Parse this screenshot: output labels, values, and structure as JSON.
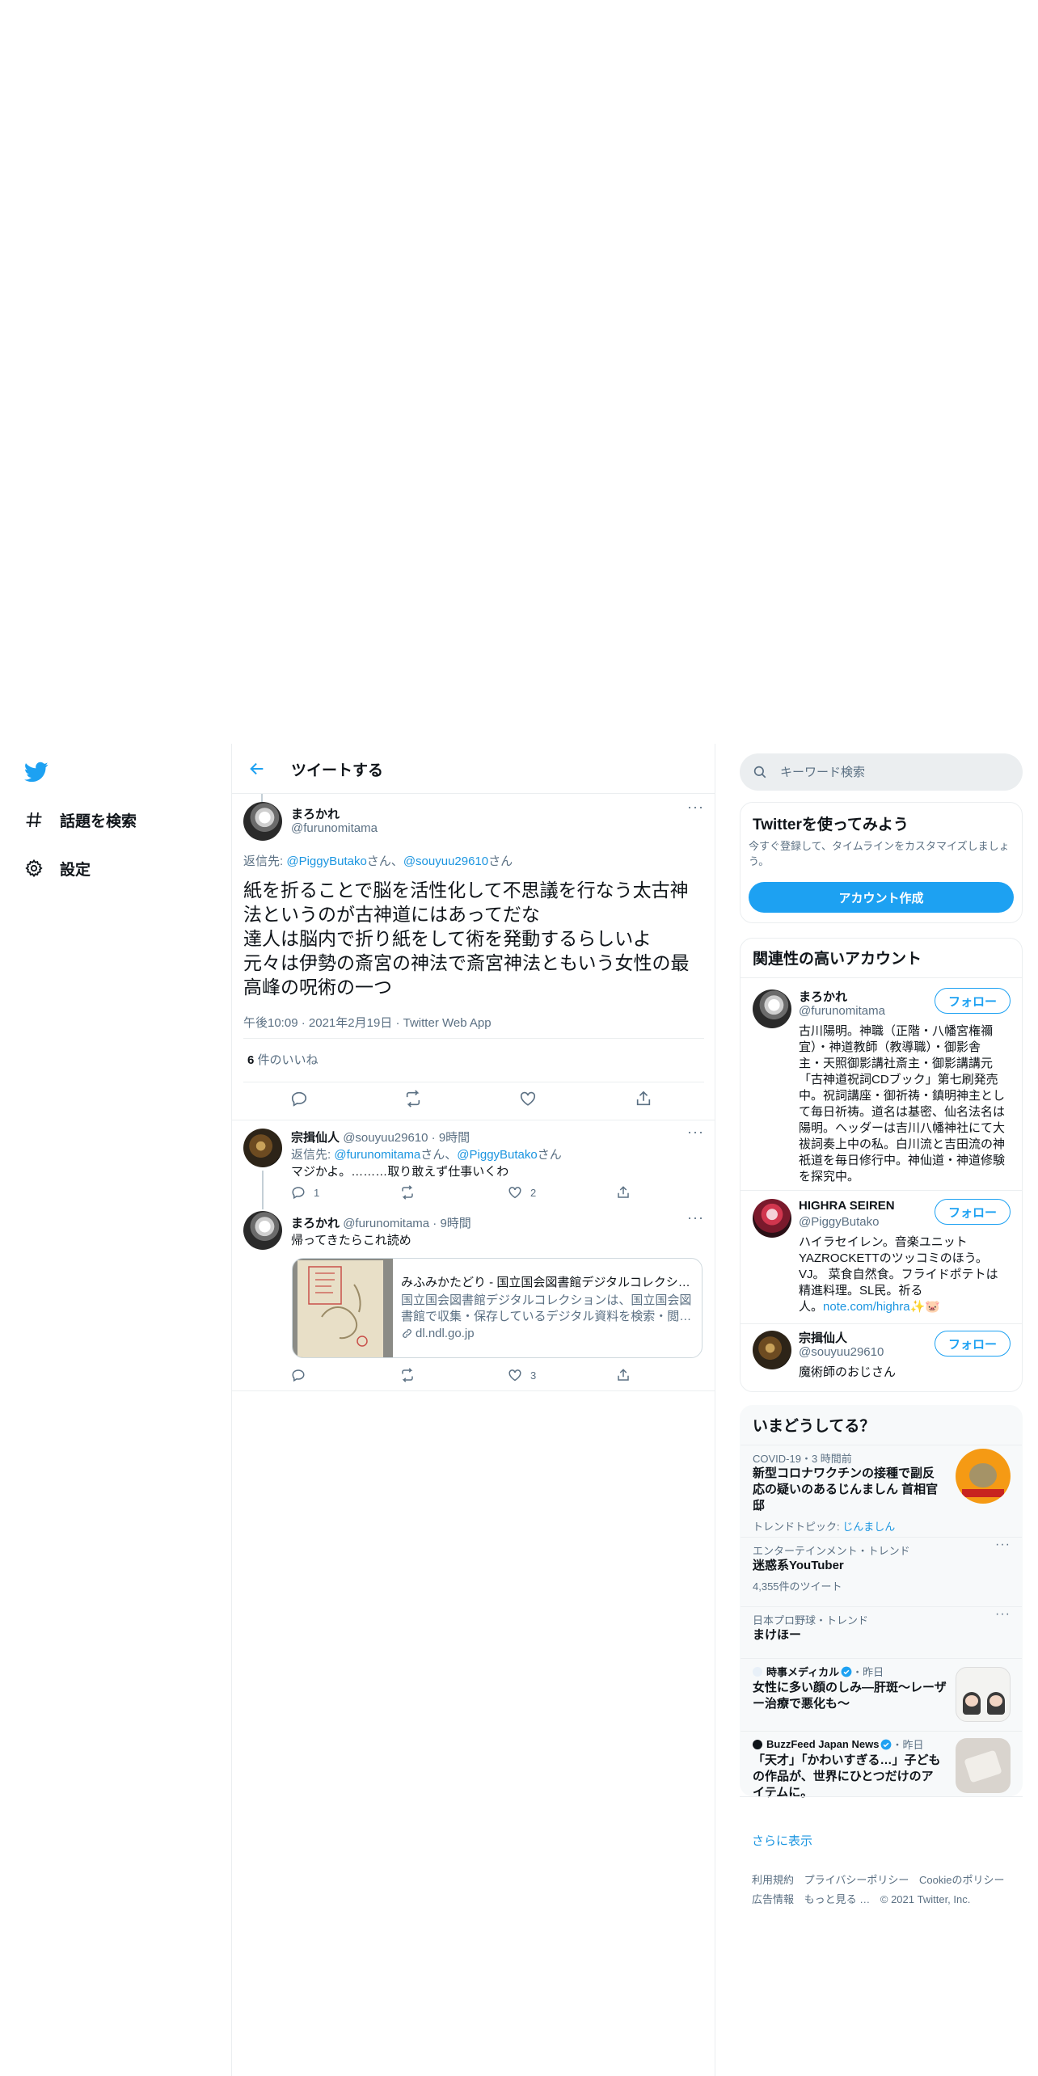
{
  "nav": {
    "logo": "twitter-bird-icon",
    "items": [
      {
        "icon": "hashtag-icon",
        "label": "話題を検索"
      },
      {
        "icon": "gear-icon",
        "label": "設定"
      }
    ]
  },
  "header": {
    "title": "ツイートする"
  },
  "tweet": {
    "name": "まろかれ",
    "handle": "@furunomitama",
    "reply_prefix": "返信先: ",
    "reply_user1": "@PiggyButako",
    "reply_sep1": "さん、",
    "reply_user2": "@souyuu29610",
    "reply_sep2": "さん",
    "text_lines": [
      "紙を折ることで脳を活性化して不思議を行なう太古神",
      "法というのが古神道にはあってだな",
      "達人は脳内で折り紙をして術を発動するらしいよ",
      "元々は伊勢の斎宮の神法で斎宮神法ともいう女性の最",
      "高峰の呪術の一つ"
    ],
    "time": "午後10:09",
    "date": "2021年2月19日",
    "source": "Twitter Web App",
    "likes_count": "6",
    "likes_label": " 件のいいね"
  },
  "replies": [
    {
      "name": "宗揖仙人",
      "handle": "@souyuu29610",
      "time": "9時間",
      "reply_prefix": "返信先: ",
      "reply_user1": "@furunomitama",
      "reply_sep1": "さん、",
      "reply_user2": "@PiggyButako",
      "reply_sep2": "さん",
      "text": "マジかよ。………取り敢えず仕事いくわ",
      "reply_count": "1",
      "retweet_count": "",
      "like_count": "2"
    },
    {
      "name": "まろかれ",
      "handle": "@furunomitama",
      "time": "9時間",
      "text": "帰ってきたらこれ読め",
      "card": {
        "title": "みふみかたどり - 国立国会図書館デジタルコレクシ…",
        "desc_line1": "国立国会図書館デジタルコレクションは、国立国会図",
        "desc_line2": "書館で収集・保存しているデジタル資料を検索・閲…",
        "domain": "dl.ndl.go.jp"
      },
      "reply_count": "",
      "retweet_count": "",
      "like_count": "3"
    }
  ],
  "search": {
    "placeholder": "キーワード検索"
  },
  "signup": {
    "title": "Twitterを使ってみよう",
    "desc_line1": "今すぐ登録して、タイムラインをカスタマイズしましょ",
    "desc_line2": "う。",
    "button": "アカウント作成"
  },
  "related": {
    "title": "関連性の高いアカウント",
    "follow_label": "フォロー",
    "accounts": [
      {
        "name": "まろかれ",
        "handle": "@furunomitama",
        "bio_lines": [
          "古川陽明。神職（正階・八幡宮権禰",
          "宜）・神道教師（教導職）・御影舎",
          "主・天照御影講社斎主・御影講講元",
          "「古神道祝詞CDブック」第七刷発売",
          "中。祝詞講座・御祈祷・鎮明神主とし",
          "て毎日祈祷。道名は基密、仙名法名は",
          "陽明。ヘッダーは吉川八幡神社にて大",
          "祓詞奏上中の私。白川流と吉田流の神",
          "祇道を毎日修行中。神仙道・神道修験",
          "を探究中。"
        ]
      },
      {
        "name": "HIGHRA SEIREN",
        "handle": "@PiggyButako",
        "bio_lines": [
          "ハイラセイレン。音楽ユニット",
          "YAZROCKETTのツッコミのほう。",
          "VJ。 菜食自然食。フライドポテトは",
          "精進料理。SL民。祈る"
        ],
        "bio_last_prefix": "人。",
        "bio_link": "note.com/highra",
        "bio_emoji": "✨🐷"
      },
      {
        "name": "宗揖仙人",
        "handle": "@souyuu29610",
        "bio_lines": [
          "魔術師のおじさん"
        ]
      }
    ]
  },
  "trends": {
    "title": "いまどうしてる？",
    "items": [
      {
        "meta": "COVID-19・3 時間前",
        "title_lines": [
          "新型コロナワクチンの接種で副反",
          "応の疑いのあるじんましん 首相官",
          "邸"
        ],
        "topic_prefix": "トレンドトピック: ",
        "topic": "じんましん"
      },
      {
        "meta": "エンターテインメント・トレンド",
        "title_lines": [
          "迷惑系YouTuber"
        ],
        "count": "4,355件のツイート"
      },
      {
        "meta": "日本プロ野球・トレンド",
        "title_lines": [
          "まけほー"
        ]
      },
      {
        "source": "時事メディカル",
        "when": "・昨日",
        "title_lines": [
          "女性に多い顔のしみ―肝斑～レーザ",
          "ー治療で悪化も～"
        ]
      },
      {
        "source": "BuzzFeed Japan News",
        "when": "・昨日",
        "title_lines": [
          "「天才」「かわいすぎる…」子ども",
          "の作品が、世界にひとつだけのア",
          "イテムに。"
        ]
      }
    ],
    "show_more": "さらに表示"
  },
  "footer": {
    "links_row1": [
      "利用規約",
      "プライバシーポリシー",
      "Cookieのポリシー"
    ],
    "links_row2": [
      "広告情報",
      "もっと見る …"
    ],
    "copyright": "© 2021 Twitter, Inc."
  },
  "colors": {
    "accent": "#1da1f2",
    "link": "#1b95e0",
    "muted": "#5b7083",
    "border": "#ebeef0"
  }
}
